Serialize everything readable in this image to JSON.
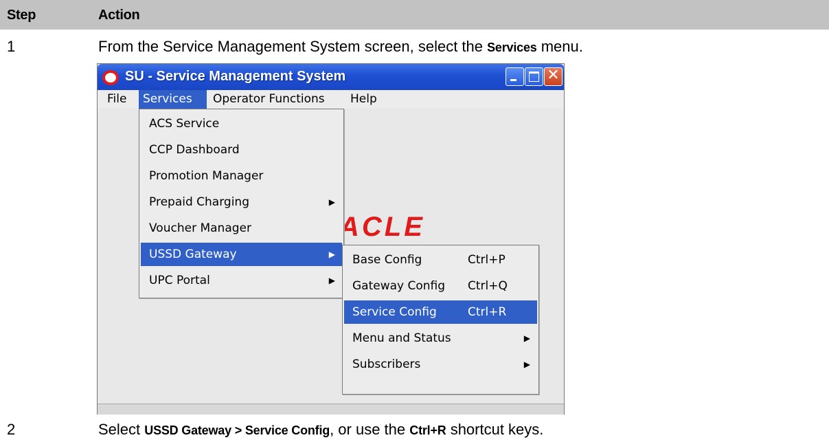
{
  "table": {
    "header_step": "Step",
    "header_action": "Action",
    "rows": [
      {
        "step": "1",
        "text_pre": "From the Service Management System screen, select the ",
        "bold": "Services",
        "text_post": " menu."
      },
      {
        "step": "2",
        "text_pre": "Select ",
        "bold": "USSD Gateway > Service Config",
        "text_mid": ", or use the ",
        "bold2": "Ctrl+R",
        "text_post": " shortcut keys."
      }
    ]
  },
  "window": {
    "title": "SU - Service Management System",
    "menubar": [
      "File",
      "Services",
      "Operator Functions",
      "Help"
    ],
    "active_menu": "Services",
    "services_menu": [
      {
        "label": "ACS Service"
      },
      {
        "label": "CCP Dashboard"
      },
      {
        "label": "Promotion Manager"
      },
      {
        "label": "Prepaid Charging",
        "submenu": true
      },
      {
        "label": "Voucher Manager"
      },
      {
        "label": "USSD Gateway",
        "submenu": true,
        "highlighted": true
      },
      {
        "label": "UPC Portal",
        "submenu": true
      }
    ],
    "ussd_menu": [
      {
        "label": "Base Config",
        "shortcut": "Ctrl+P"
      },
      {
        "label": "Gateway Config",
        "shortcut": "Ctrl+Q"
      },
      {
        "label": "Service Config",
        "shortcut": "Ctrl+R",
        "highlighted": true
      },
      {
        "label": "Menu and Status",
        "submenu": true
      },
      {
        "label": "Subscribers",
        "submenu": true
      }
    ]
  },
  "colors": {
    "header_bg": "#c2c2c2",
    "titlebar": "#1e4fd3",
    "highlight": "#2f5fc7",
    "logo_red": "#e01b1b"
  },
  "icons": [
    "oracle-logo-icon",
    "minimize-icon",
    "maximize-icon",
    "close-icon",
    "submenu-arrow-icon"
  ]
}
